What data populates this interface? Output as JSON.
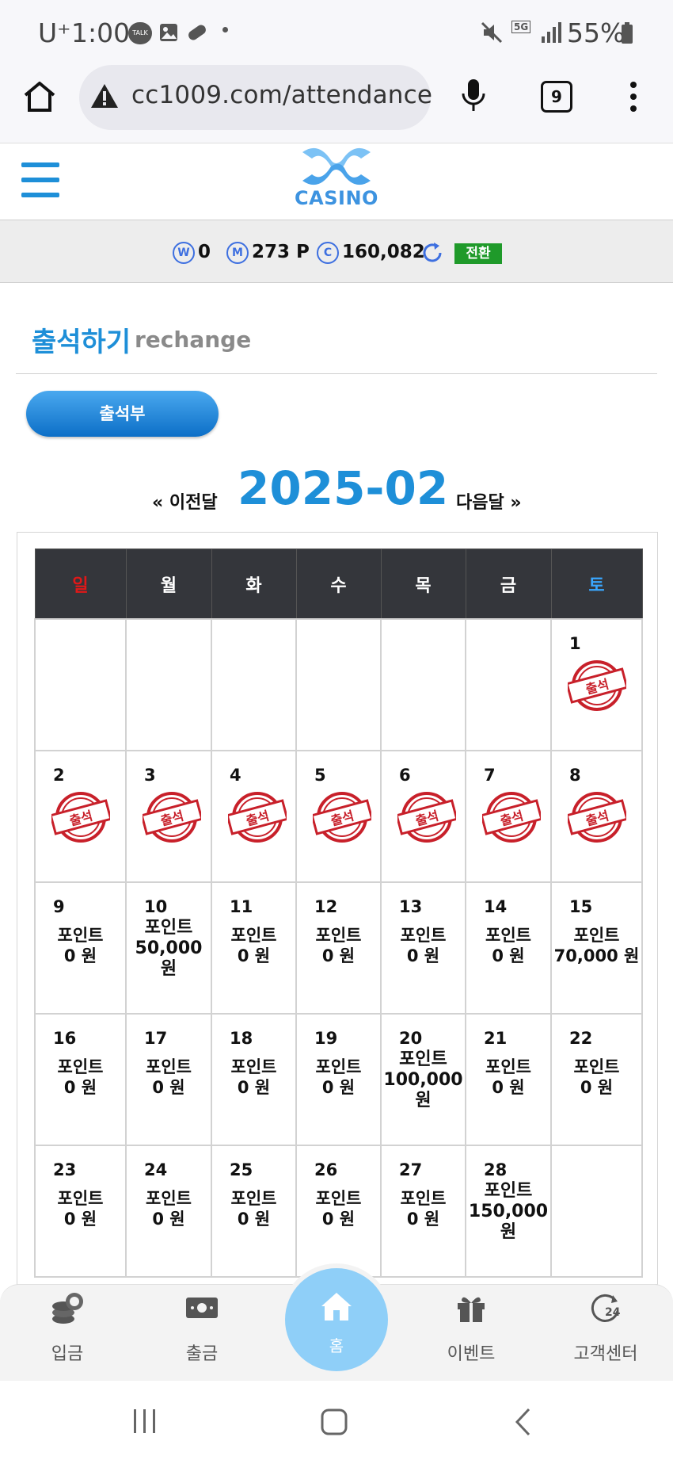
{
  "status_bar": {
    "time": "1:00",
    "carrier": "U⁺",
    "talk_badge": "TALK",
    "network": "5G",
    "battery": "55%"
  },
  "browser": {
    "url": "cc1009.com/attendance",
    "tab_count": "9"
  },
  "header": {
    "logo_text": "CASINO"
  },
  "balance": {
    "w_icon": "W",
    "w_value": "0",
    "m_icon": "M",
    "m_value": "273 P",
    "c_icon": "C",
    "c_value": "160,082",
    "convert_label": "전환"
  },
  "page": {
    "title": "출석하기",
    "subtitle": "rechange",
    "attendance_button": "출석부"
  },
  "calendar_nav": {
    "prev": "« 이전달",
    "month": "2025-02",
    "next": "다음달 »"
  },
  "calendar": {
    "weekdays": [
      "일",
      "월",
      "화",
      "수",
      "목",
      "금",
      "토"
    ],
    "weekday_colors": [
      "#e01818",
      "#ffffff",
      "#ffffff",
      "#ffffff",
      "#ffffff",
      "#ffffff",
      "#3aa7ff"
    ],
    "stamp_text": "출석",
    "weeks": [
      [
        {
          "day": ""
        },
        {
          "day": ""
        },
        {
          "day": ""
        },
        {
          "day": ""
        },
        {
          "day": ""
        },
        {
          "day": ""
        },
        {
          "day": "1",
          "stamp": true
        }
      ],
      [
        {
          "day": "2",
          "stamp": true
        },
        {
          "day": "3",
          "stamp": true
        },
        {
          "day": "4",
          "stamp": true
        },
        {
          "day": "5",
          "stamp": true
        },
        {
          "day": "6",
          "stamp": true
        },
        {
          "day": "7",
          "stamp": true
        },
        {
          "day": "8",
          "stamp": true
        }
      ],
      [
        {
          "day": "9",
          "label": "포인트",
          "amount": "0 원"
        },
        {
          "day": "10",
          "label": "포인트",
          "amount": "50,000",
          "unit": "원"
        },
        {
          "day": "11",
          "label": "포인트",
          "amount": "0 원"
        },
        {
          "day": "12",
          "label": "포인트",
          "amount": "0 원"
        },
        {
          "day": "13",
          "label": "포인트",
          "amount": "0 원"
        },
        {
          "day": "14",
          "label": "포인트",
          "amount": "0 원"
        },
        {
          "day": "15",
          "label": "포인트",
          "amount": "70,000 원"
        }
      ],
      [
        {
          "day": "16",
          "label": "포인트",
          "amount": "0 원"
        },
        {
          "day": "17",
          "label": "포인트",
          "amount": "0 원"
        },
        {
          "day": "18",
          "label": "포인트",
          "amount": "0 원"
        },
        {
          "day": "19",
          "label": "포인트",
          "amount": "0 원"
        },
        {
          "day": "20",
          "label": "포인트",
          "amount": "100,000",
          "unit": "원"
        },
        {
          "day": "21",
          "label": "포인트",
          "amount": "0 원"
        },
        {
          "day": "22",
          "label": "포인트",
          "amount": "0 원"
        }
      ],
      [
        {
          "day": "23",
          "label": "포인트",
          "amount": "0 원"
        },
        {
          "day": "24",
          "label": "포인트",
          "amount": "0 원"
        },
        {
          "day": "25",
          "label": "포인트",
          "amount": "0 원"
        },
        {
          "day": "26",
          "label": "포인트",
          "amount": "0 원"
        },
        {
          "day": "27",
          "label": "포인트",
          "amount": "0 원"
        },
        {
          "day": "28",
          "label": "포인트",
          "amount": "150,000",
          "unit": "원"
        },
        {
          "day": ""
        }
      ]
    ]
  },
  "bottom_nav": {
    "deposit": "입금",
    "withdraw": "출금",
    "home": "홈",
    "event": "이벤트",
    "support": "고객센터",
    "support_badge": "24"
  },
  "colors": {
    "accent": "#1e8fd8",
    "header_dark": "#34363b",
    "stamp_red": "#c8202a",
    "convert_green": "#1f9a2a",
    "home_circle": "#8fcff8"
  }
}
